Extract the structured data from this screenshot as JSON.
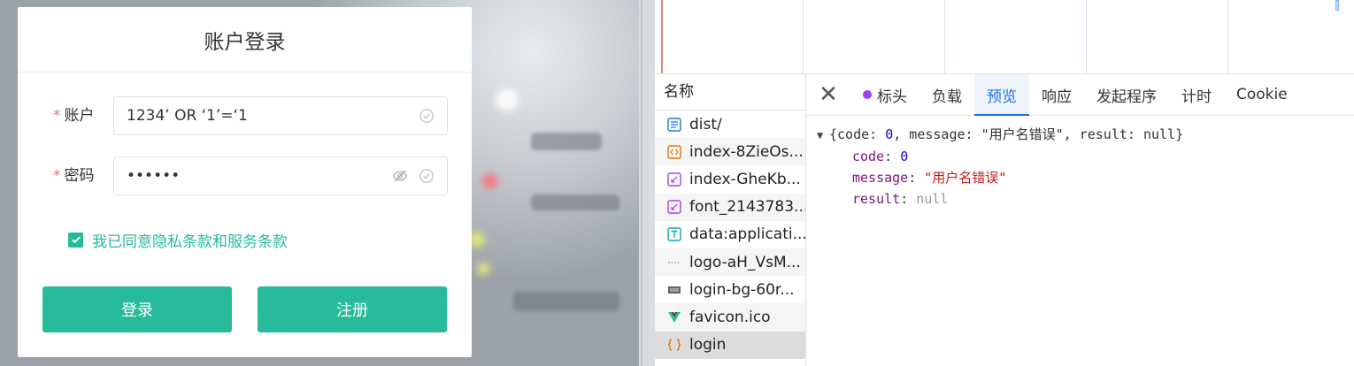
{
  "login": {
    "title": "账户登录",
    "account_label": "账户",
    "account_value": "1234’ OR ‘1’=‘1",
    "password_label": "密码",
    "password_value": "••••••",
    "agreement": "我已同意隐私条款和服务条款",
    "login_button": "登录",
    "register_button": "注册",
    "required_mark": "*"
  },
  "devtools": {
    "name_header": "名称",
    "requests": [
      {
        "name": "dist/",
        "icon": "document-icon"
      },
      {
        "name": "index-8ZieOs...",
        "icon": "script-icon"
      },
      {
        "name": "index-GheKb...",
        "icon": "stylesheet-icon"
      },
      {
        "name": "font_2143783...",
        "icon": "font-icon"
      },
      {
        "name": "data:applicati...",
        "icon": "text-icon"
      },
      {
        "name": "logo-aH_VsM...",
        "icon": "image-icon"
      },
      {
        "name": "login-bg-60r...",
        "icon": "image-icon"
      },
      {
        "name": "favicon.ico",
        "icon": "vue-icon"
      },
      {
        "name": "login",
        "icon": "fetch-icon"
      }
    ],
    "tabs": [
      "标头",
      "负载",
      "预览",
      "响应",
      "发起程序",
      "计时",
      "Cookie"
    ],
    "active_tab": "预览",
    "preview": {
      "summary_prefix": "{code: ",
      "summary_code": "0",
      "summary_mid": ", message: ",
      "summary_message": "\"用户名错误\"",
      "summary_mid2": ", result: ",
      "summary_result": "null",
      "summary_suffix": "}",
      "code_key": "code",
      "code_val": "0",
      "message_key": "message",
      "message_val": "\"用户名错误\"",
      "result_key": "result",
      "result_val": "null"
    }
  },
  "colors": {
    "accent": "#27ba9b",
    "devtools_blue": "#1a73e8"
  }
}
